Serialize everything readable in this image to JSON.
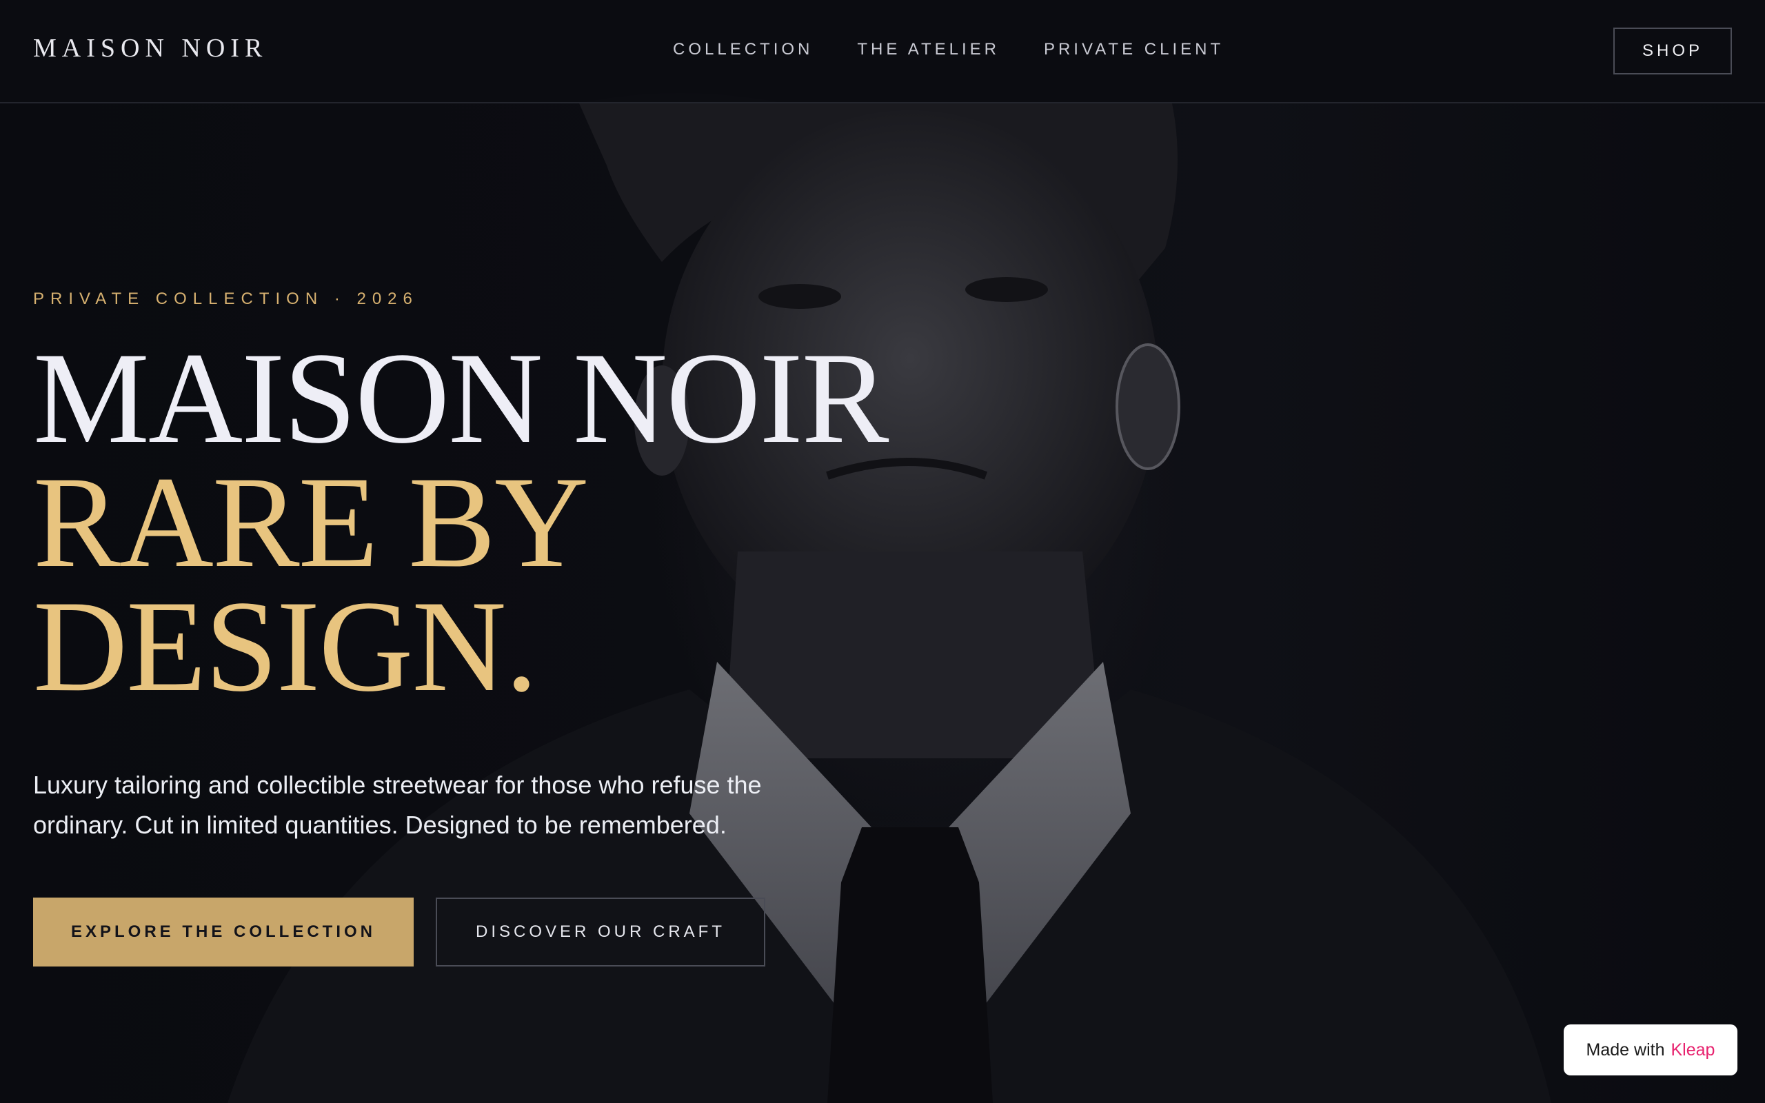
{
  "nav": {
    "brand": "MAISON NOIR",
    "links": [
      {
        "label": "COLLECTION"
      },
      {
        "label": "THE ATELIER"
      },
      {
        "label": "PRIVATE CLIENT"
      }
    ],
    "shop_label": "SHOP"
  },
  "hero": {
    "eyebrow": "PRIVATE COLLECTION · 2026",
    "headline_line1": "MAISON NOIR",
    "headline_line2": "RARE BY",
    "headline_line3": "DESIGN.",
    "lede": "Luxury tailoring and collectible streetwear for those who refuse the ordinary. Cut in limited quantities. Designed to be remembered.",
    "primary_cta": "EXPLORE THE COLLECTION",
    "secondary_cta": "DISCOVER OUR CRAFT"
  },
  "badge": {
    "prefix": "Made with",
    "brand": "Kleap"
  },
  "colors": {
    "background": "#0a0b10",
    "accent_gold": "#c8a66a",
    "headline_gold": "#e8c47f",
    "badge_brand": "#e8236f"
  }
}
